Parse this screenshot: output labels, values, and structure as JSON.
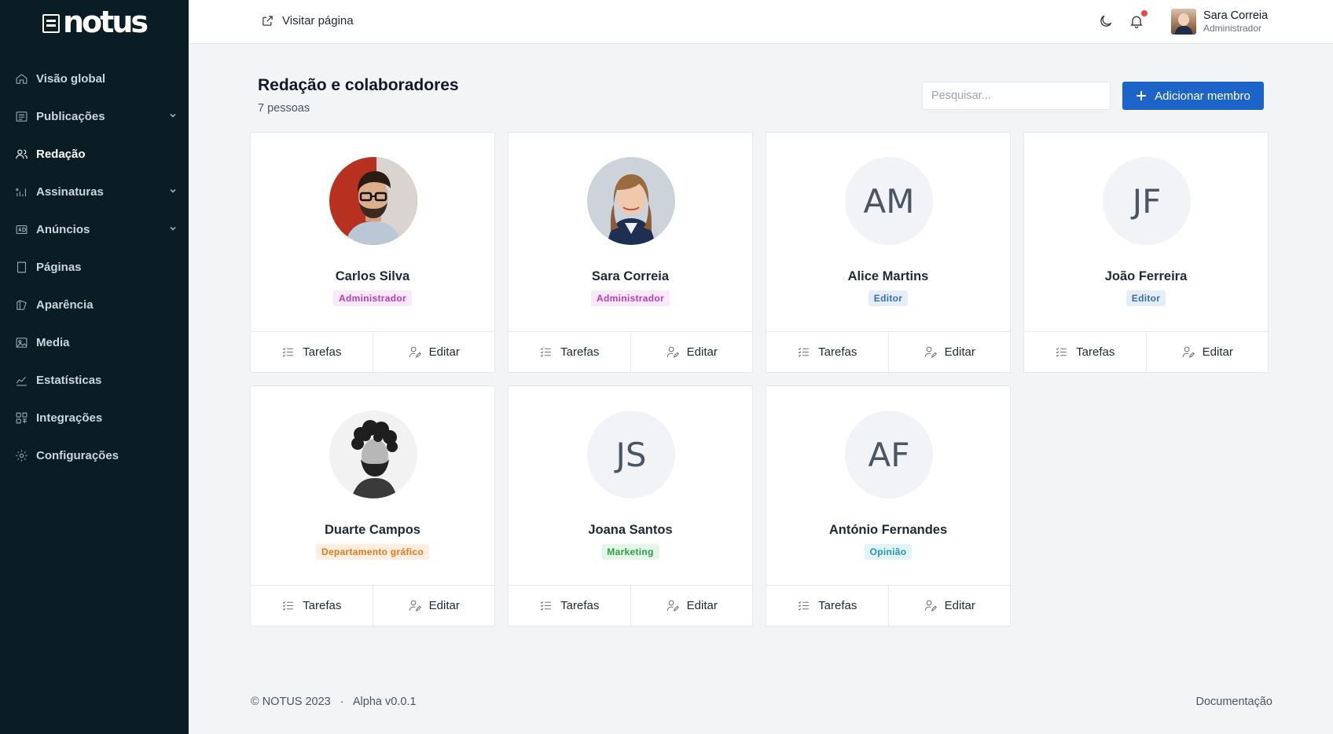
{
  "app": {
    "logo_text": "notus"
  },
  "sidebar": {
    "items": [
      {
        "label": "Visão global",
        "icon": "home-icon",
        "chevron": false,
        "active": false
      },
      {
        "label": "Publicações",
        "icon": "list-icon",
        "chevron": true,
        "active": false
      },
      {
        "label": "Redação",
        "icon": "users-icon",
        "chevron": false,
        "active": true
      },
      {
        "label": "Assinaturas",
        "icon": "chart-icon",
        "chevron": true,
        "active": false
      },
      {
        "label": "Anúncios",
        "icon": "ad-icon",
        "chevron": true,
        "active": false
      },
      {
        "label": "Páginas",
        "icon": "page-icon",
        "chevron": false,
        "active": false
      },
      {
        "label": "Aparência",
        "icon": "palette-icon",
        "chevron": false,
        "active": false
      },
      {
        "label": "Media",
        "icon": "image-icon",
        "chevron": false,
        "active": false
      },
      {
        "label": "Estatísticas",
        "icon": "stats-icon",
        "chevron": false,
        "active": false
      },
      {
        "label": "Integrações",
        "icon": "grid-icon",
        "chevron": false,
        "active": false
      },
      {
        "label": "Configurações",
        "icon": "gear-icon",
        "chevron": false,
        "active": false
      }
    ]
  },
  "topbar": {
    "visit_label": "Visitar página",
    "user": {
      "name": "Sara Correia",
      "role": "Administrador"
    }
  },
  "page": {
    "title": "Redação e colaboradores",
    "subtitle": "7 pessoas",
    "search_placeholder": "Pesquisar...",
    "add_button": "Adicionar membro"
  },
  "members": [
    {
      "name": "Carlos Silva",
      "role": "Administrador",
      "badge": "admin",
      "avatar": "photo-carlos"
    },
    {
      "name": "Sara Correia",
      "role": "Administrador",
      "badge": "admin",
      "avatar": "photo-sara"
    },
    {
      "name": "Alice Martins",
      "role": "Editor",
      "badge": "editor",
      "initials": "AM"
    },
    {
      "name": "João Ferreira",
      "role": "Editor",
      "badge": "editor",
      "initials": "JF"
    },
    {
      "name": "Duarte Campos",
      "role": "Departamento gráfico",
      "badge": "design",
      "avatar": "photo-duarte"
    },
    {
      "name": "Joana Santos",
      "role": "Marketing",
      "badge": "mkt",
      "initials": "JS"
    },
    {
      "name": "António Fernandes",
      "role": "Opinião",
      "badge": "opinion",
      "initials": "AF"
    }
  ],
  "card_actions": {
    "tasks": "Tarefas",
    "edit": "Editar"
  },
  "footer": {
    "copyright": "© NOTUS 2023",
    "separator": "·",
    "version": "Alpha v0.0.1",
    "docs": "Documentação"
  },
  "colors": {
    "sidebar_bg": "#0b1d24",
    "primary": "#1d64c8",
    "notification_dot": "#ef4444"
  }
}
